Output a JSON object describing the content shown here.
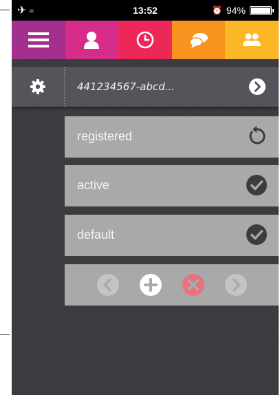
{
  "statusbar": {
    "airplane_icon": "airplane-icon",
    "wifi_icon": "wifi-icon",
    "time": "13:52",
    "battery_text": "94%",
    "battery_level": 0.94
  },
  "tabs": [
    {
      "name": "menu",
      "icon": "hamburger-icon",
      "color": "#a32f8e"
    },
    {
      "name": "profile",
      "icon": "user-icon",
      "color": "#d62d8b"
    },
    {
      "name": "history",
      "icon": "clock-icon",
      "color": "#ee2759"
    },
    {
      "name": "chat",
      "icon": "chat-bubbles-icon",
      "color": "#f7931e"
    },
    {
      "name": "contacts",
      "icon": "group-icon",
      "color": "#fbb726"
    }
  ],
  "device": {
    "id_text": "441234567-abcd...",
    "settings_icon": "gear-icon",
    "go_icon": "chevron-right-circle-icon"
  },
  "rows": [
    {
      "label": "registered",
      "icon": "refresh-icon"
    },
    {
      "label": "active",
      "icon": "check-circle-icon"
    },
    {
      "label": "default",
      "icon": "check-circle-icon"
    }
  ],
  "actions": [
    {
      "name": "previous",
      "icon": "chevron-left-circle-icon",
      "enabled": false
    },
    {
      "name": "add",
      "icon": "plus-circle-icon",
      "enabled": true
    },
    {
      "name": "delete",
      "icon": "x-circle-icon",
      "enabled": false
    },
    {
      "name": "next",
      "icon": "chevron-right-circle-icon",
      "enabled": false
    }
  ],
  "colors": {
    "delete_accent": "#e8737f",
    "disabled_icon": "#c4c4c4",
    "row_bg": "#a9a9a9",
    "device_bar_bg": "#54555a"
  }
}
